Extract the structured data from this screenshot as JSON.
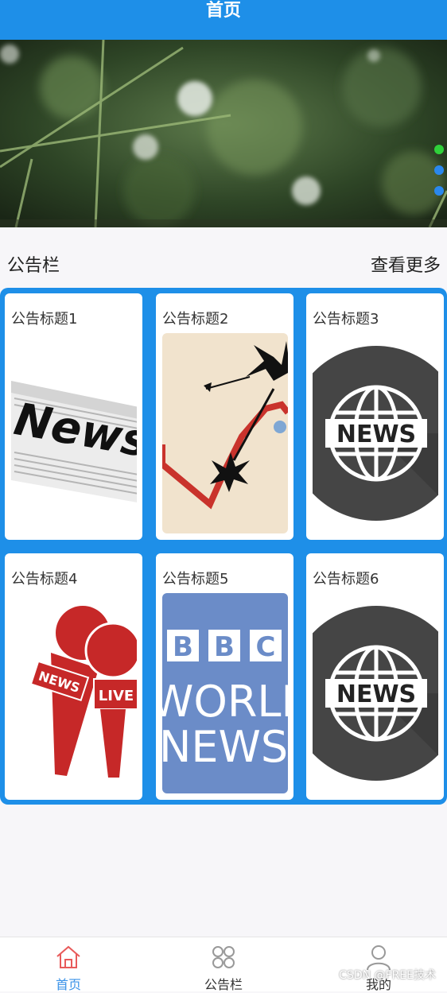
{
  "header": {
    "title": "首页"
  },
  "banner": {
    "dots": [
      "#2fd13a",
      "#2a88ee",
      "#2a88ee"
    ]
  },
  "notice": {
    "title": "公告栏",
    "more": "查看更多",
    "items": [
      {
        "title": "公告标题1",
        "image": "newspaper-image"
      },
      {
        "title": "公告标题2",
        "image": "stock-chart-image"
      },
      {
        "title": "公告标题3",
        "image": "news-globe-image"
      },
      {
        "title": "公告标题4",
        "image": "microphones-image"
      },
      {
        "title": "公告标题5",
        "image": "bbc-world-news-image"
      },
      {
        "title": "公告标题6",
        "image": "news-globe-image"
      }
    ],
    "image_text": {
      "newspaper": "News",
      "globe": "NEWS",
      "mic_left": "NEWS",
      "mic_right": "LIVE",
      "bbc_b1": "B",
      "bbc_b2": "B",
      "bbc_c": "C",
      "bbc_world": "WORLD",
      "bbc_news": "NEWS"
    }
  },
  "tabbar": {
    "tabs": [
      {
        "label": "首页",
        "icon": "home-icon",
        "active": true
      },
      {
        "label": "公告栏",
        "icon": "grid-icon",
        "active": false
      },
      {
        "label": "我的",
        "icon": "user-icon",
        "active": false
      }
    ],
    "active_color": "#3a92e8",
    "inactive_color": "#333333"
  },
  "watermark": "CSDN @FREE技术",
  "colors": {
    "primary": "#1e8fe8",
    "background": "#f7f6f9"
  }
}
